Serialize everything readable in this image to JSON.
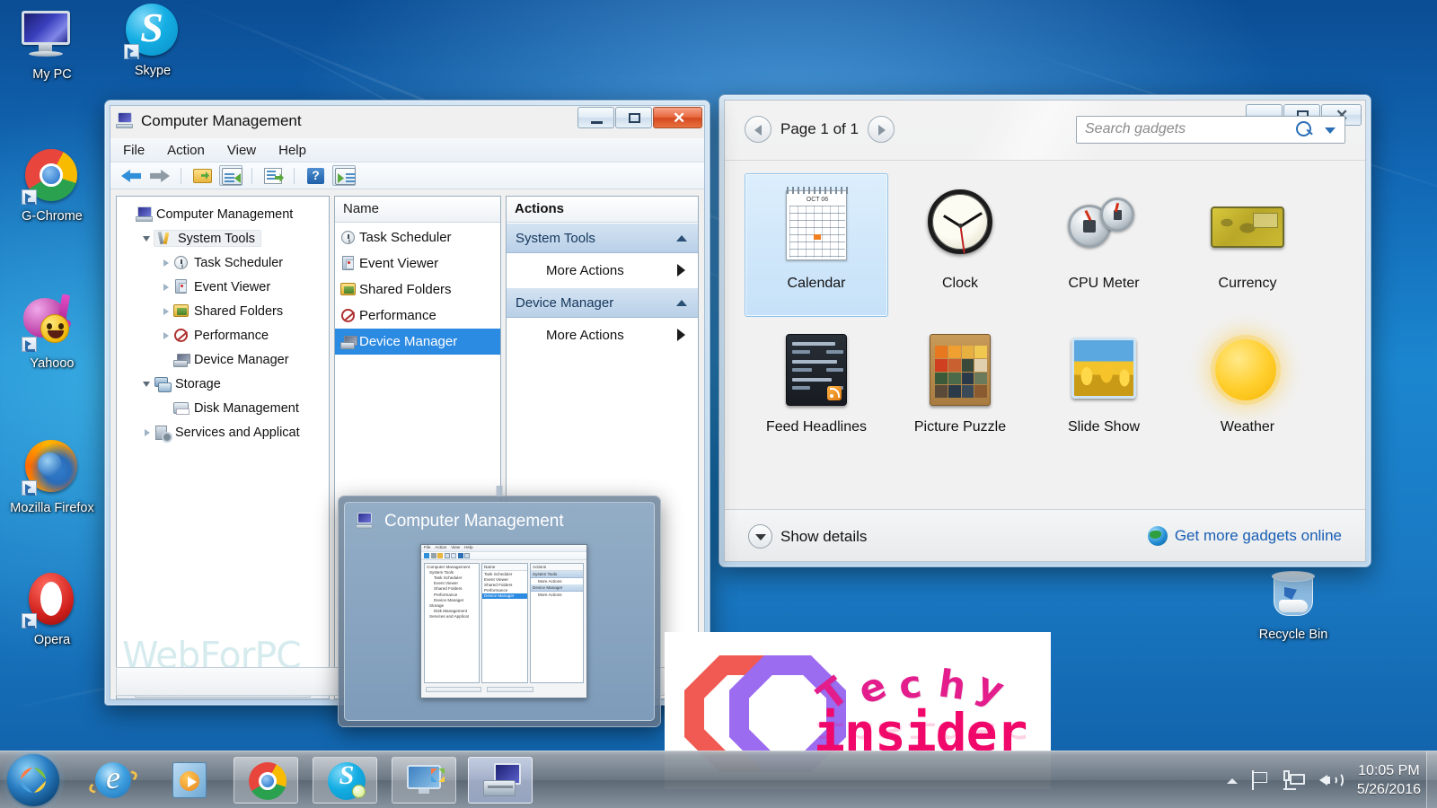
{
  "desktop": {
    "icons": [
      {
        "label": "My PC",
        "icon": "computer-icon",
        "shortcut": false
      },
      {
        "label": "Skype",
        "icon": "skype-icon",
        "shortcut": true
      },
      {
        "label": "G-Chrome",
        "icon": "chrome-icon",
        "shortcut": true
      },
      {
        "label": "Yahooo",
        "icon": "yahoo-messenger-icon",
        "shortcut": true
      },
      {
        "label": "Mozilla Firefox",
        "icon": "firefox-icon",
        "shortcut": true
      },
      {
        "label": "Opera",
        "icon": "opera-icon",
        "shortcut": true
      },
      {
        "label": "Recycle Bin",
        "icon": "recycle-bin-icon",
        "shortcut": false
      }
    ]
  },
  "computer_management": {
    "title": "Computer Management",
    "menu": [
      "File",
      "Action",
      "View",
      "Help"
    ],
    "toolbar": [
      "back-arrow-icon",
      "forward-arrow-icon",
      "up-folder-icon",
      "show-hide-tree-icon",
      "export-list-icon",
      "help-icon",
      "show-action-pane-icon"
    ],
    "tree": [
      {
        "label": "Computer Management",
        "indent": 0,
        "expander": "none",
        "icon": "computer-management-icon",
        "selected": false
      },
      {
        "label": "System Tools",
        "indent": 1,
        "expander": "open",
        "icon": "system-tools-icon",
        "selected": true
      },
      {
        "label": "Task Scheduler",
        "indent": 2,
        "expander": "closed",
        "icon": "clock-icon",
        "selected": false
      },
      {
        "label": "Event Viewer",
        "indent": 2,
        "expander": "closed",
        "icon": "event-viewer-icon",
        "selected": false
      },
      {
        "label": "Shared Folders",
        "indent": 2,
        "expander": "closed",
        "icon": "shared-folders-icon",
        "selected": false
      },
      {
        "label": "Performance",
        "indent": 2,
        "expander": "closed",
        "icon": "performance-icon",
        "selected": false
      },
      {
        "label": "Device Manager",
        "indent": 2,
        "expander": "none",
        "icon": "device-manager-icon",
        "selected": false
      },
      {
        "label": "Storage",
        "indent": 1,
        "expander": "open",
        "icon": "storage-icon",
        "selected": false
      },
      {
        "label": "Disk Management",
        "indent": 2,
        "expander": "none",
        "icon": "disk-management-icon",
        "selected": false
      },
      {
        "label": "Services and Applicat",
        "indent": 1,
        "expander": "closed",
        "icon": "services-icon",
        "selected": false
      }
    ],
    "list": {
      "column_header": "Name",
      "rows": [
        {
          "label": "Task Scheduler",
          "icon": "clock-icon",
          "selected": false
        },
        {
          "label": "Event Viewer",
          "icon": "event-viewer-icon",
          "selected": false
        },
        {
          "label": "Shared Folders",
          "icon": "shared-folders-icon",
          "selected": false
        },
        {
          "label": "Performance",
          "icon": "performance-icon",
          "selected": false
        },
        {
          "label": "Device Manager",
          "icon": "device-manager-icon",
          "selected": true
        }
      ]
    },
    "actions": {
      "header": "Actions",
      "groups": [
        {
          "title": "System Tools",
          "items": [
            "More Actions"
          ]
        },
        {
          "title": "Device Manager",
          "items": [
            "More Actions"
          ]
        }
      ]
    },
    "watermark": "WebForPC",
    "window_buttons": {
      "minimize": "minimize-icon",
      "maximize": "maximize-icon",
      "close": "close-icon"
    }
  },
  "gadgets": {
    "page_label": "Page 1 of 1",
    "search_placeholder": "Search gadgets",
    "items": [
      {
        "label": "Calendar",
        "selected": true,
        "thumb": "calendar-thumb",
        "calendar_month": "OCT 06"
      },
      {
        "label": "Clock",
        "selected": false,
        "thumb": "clock-thumb"
      },
      {
        "label": "CPU Meter",
        "selected": false,
        "thumb": "cpu-meter-thumb"
      },
      {
        "label": "Currency",
        "selected": false,
        "thumb": "currency-thumb"
      },
      {
        "label": "Feed Headlines",
        "selected": false,
        "thumb": "feed-headlines-thumb"
      },
      {
        "label": "Picture Puzzle",
        "selected": false,
        "thumb": "picture-puzzle-thumb"
      },
      {
        "label": "Slide Show",
        "selected": false,
        "thumb": "slide-show-thumb"
      },
      {
        "label": "Weather",
        "selected": false,
        "thumb": "weather-thumb"
      }
    ],
    "show_details": "Show details",
    "get_more": "Get more gadgets online",
    "window_buttons": {
      "minimize": "minimize-icon",
      "maximize": "maximize-icon",
      "close": "close-icon"
    }
  },
  "thumbnail_preview": {
    "title": "Computer Management",
    "mini": {
      "menu": [
        "File",
        "Action",
        "View",
        "Help"
      ],
      "tree": [
        "Computer Management",
        "System Tools",
        "Task Scheduler",
        "Event Viewer",
        "Shared Folders",
        "Performance",
        "Device Manager",
        "Storage",
        "Disk Management",
        "Services and Applicat"
      ],
      "list_header": "Name",
      "list": [
        "Task Scheduler",
        "Event Viewer",
        "Shared Folders",
        "Performance",
        "Device Manager"
      ],
      "actions_header": "Actions",
      "action_groups": [
        {
          "title": "System Tools",
          "item": "More Actions"
        },
        {
          "title": "Device Manager",
          "item": "More Actions"
        }
      ]
    }
  },
  "logo": {
    "word_top": "Techy",
    "word_bottom": "insider",
    "colors": {
      "octagon_left": "#f05a52",
      "octagon_right": "#9b6bf0",
      "techy": "#e31e8c",
      "insider": "#f0086b"
    }
  },
  "taskbar": {
    "start": "start-orb-icon",
    "items": [
      {
        "name": "internet-explorer",
        "state": "pinned"
      },
      {
        "name": "windows-media-player",
        "state": "pinned"
      },
      {
        "name": "google-chrome",
        "state": "open"
      },
      {
        "name": "skype",
        "state": "open"
      },
      {
        "name": "desktop-gadgets",
        "state": "open"
      },
      {
        "name": "computer-management",
        "state": "active"
      }
    ],
    "tray": [
      "show-hidden-icons-arrow",
      "action-center-flag-icon",
      "network-icon",
      "volume-icon"
    ],
    "time": "10:05 PM",
    "date": "5/26/2016"
  }
}
